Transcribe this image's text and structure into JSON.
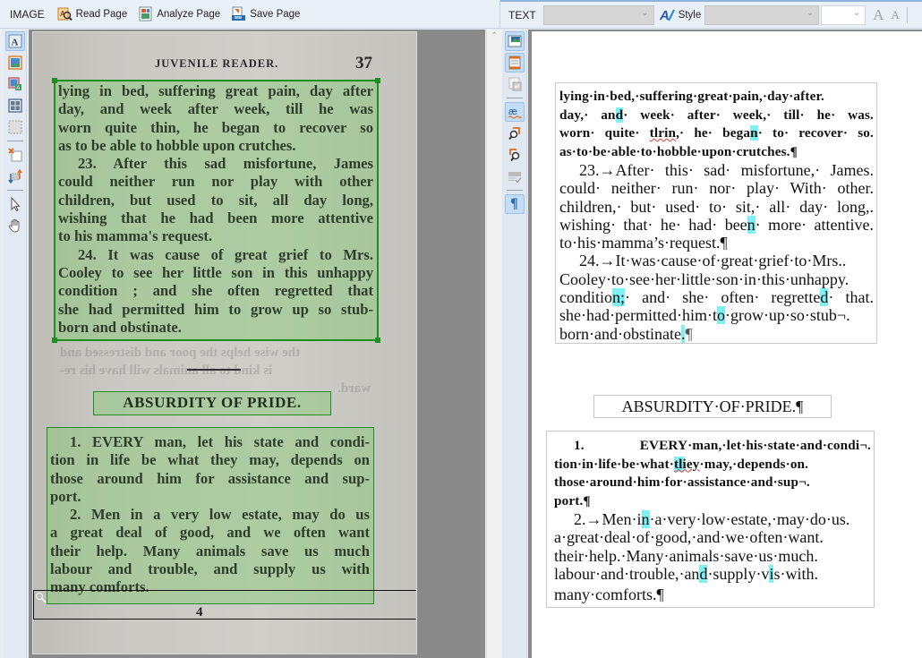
{
  "image_toolbar": {
    "label": "IMAGE",
    "buttons": [
      {
        "label": "Read Page",
        "icon": "read-page-icon"
      },
      {
        "label": "Analyze Page",
        "icon": "analyze-page-icon"
      },
      {
        "label": "Save Page",
        "icon": "save-page-icon"
      }
    ]
  },
  "text_toolbar": {
    "label": "TEXT",
    "paragraph_style_value": "",
    "style_label": "Style",
    "font_value": "",
    "font_size_value": "",
    "increase_font_label": "A",
    "decrease_font_label": "A"
  },
  "image_tools": [
    {
      "name": "text-area-tool",
      "active": true
    },
    {
      "name": "picture-area-tool",
      "active": false
    },
    {
      "name": "background-picture-tool",
      "active": false
    },
    {
      "name": "table-area-tool",
      "active": false
    },
    {
      "name": "barcode-area-tool",
      "active": false
    },
    {
      "name": "delete-area-tool",
      "active": false
    },
    {
      "name": "order-areas-tool",
      "active": false
    },
    {
      "name": "select-tool",
      "active": false
    },
    {
      "name": "hand-tool",
      "active": false
    }
  ],
  "text_tools": [
    {
      "name": "show-pictures-tool",
      "active": true
    },
    {
      "name": "show-headers-footers-tool",
      "active": true
    },
    {
      "name": "show-line-breaks-tool",
      "active": false
    },
    {
      "name": "highlight-uncertain-tool",
      "active": true
    },
    {
      "name": "previous-uncertain-tool",
      "active": false
    },
    {
      "name": "next-uncertain-tool",
      "active": false
    },
    {
      "name": "verify-text-tool",
      "active": false
    },
    {
      "name": "show-formatting-tool",
      "active": true
    }
  ],
  "scan": {
    "running_head": "JUVENILE READER.",
    "page_number": "37",
    "footer_mark": "4",
    "block1_lines": [
      "lying in bed, suffering great pain, day after",
      "day, and week after week, till he was",
      "worn quite thin, he began to recover so",
      "as to be able to hobble upon crutches.",
      "23. After this sad misfortune, James",
      "could neither run nor play with other",
      "children, but used to sit, all day long,",
      "wishing that he had been more attentive",
      "to his mamma's request.",
      "24. It was cause of great grief to Mrs.",
      "Cooley to see her little son in this unhappy",
      "condition ; and she often regretted that",
      "she had permitted him to grow up so stub-",
      "born and obstinate."
    ],
    "bleed_lines": [
      "the wise helps the poor and distressed and",
      "is kind to all animals will have his re-",
      "ward."
    ],
    "heading": "ABSURDITY OF PRIDE.",
    "block2_lines": [
      "1. EVERY man, let his state and condi-",
      "tion in life be what they may, depends on",
      "those around him for assistance and sup-",
      "port.",
      "2. Men in a very low estate, may do us",
      "a great deal of good, and we often want",
      "their help. Many animals save us much",
      "labour and trouble, and supply us with",
      "many comforts."
    ]
  },
  "recognized": {
    "heading": "ABSURDITY·OF·PRIDE.¶",
    "para1": [
      [
        "lying·in·bed,·suffering·great·pain,·day·after.",
        "",
        "",
        ""
      ],
      [
        "day,· an",
        "d",
        "· week· after· week,· till· he· was.",
        ""
      ],
      [
        "worn· quite· ",
        "",
        "",
        ""
      ],
      [
        "as·to·be·able·to·hobble·upon·crutches.¶",
        "",
        "",
        ""
      ]
    ],
    "p1_l3_sq": "tlrin",
    "p1_l3_mid": ",· he· bega",
    "p1_l3_hl": "n",
    "p1_l3_end": "· to· recover· so.",
    "para2": [
      "23.→After· this· sad· misfortune,· James.",
      "could· neither· run· nor· play· With· other.",
      "children,· but· used· to· sit,· all· day· long,.",
      "wishing· that· he· had· bee",
      "to·his·mamma’s·request.¶"
    ],
    "p2_l4_hl": "n",
    "p2_l4_end": "· more· attentive.",
    "para3": {
      "l1": "24.→It·was·cause·of·great·grief·to·Mrs..",
      "l2": "Cooley·to·see·her·little·son·in·this·unhappy.",
      "l3a": "conditio",
      "l3hl": "n;",
      "l3b": "· and· she· often· regrette",
      "l3hl2": "d",
      "l3c": "· that.",
      "l4a": "she·had·permitted·him·t",
      "l4hl": "o",
      "l4b": "·grow·up·so·stub¬.",
      "l5a": "born·and·obstinate",
      "l5hl": ".",
      "l5b": "¶"
    },
    "para4": {
      "l1": "1.  EVERY·man,·let·his·state·and·condi¬.",
      "l2a": "tion·in·life·be·what·",
      "l2sq": "tliey",
      "l2b": "·may,·depends·on.",
      "l3": "those·around·him·for·assistance·and·sup¬.",
      "l4": "port.¶"
    },
    "para5": {
      "l1a": "2.→Men·i",
      "l1hl": "n",
      "l1b": "·a·very·low·estate,·may·do·us.",
      "l2": "a·great·deal·of·good,·and·we·often·want.",
      "l3": "their·help.·Many·animals·save·us·much.",
      "l4a": "labour·and·trouble,·an",
      "l4hl": "d",
      "l4b": "·supply·v",
      "l4hl2": "i",
      "l4c": "s·with.",
      "l5": "many·comforts.¶"
    }
  },
  "colors": {
    "text_block_border": "#1e8f1e",
    "text_block_fill": "#78c864",
    "uncertain_highlight": "#7ff0f4",
    "active_tool": "#c4dcf5"
  }
}
